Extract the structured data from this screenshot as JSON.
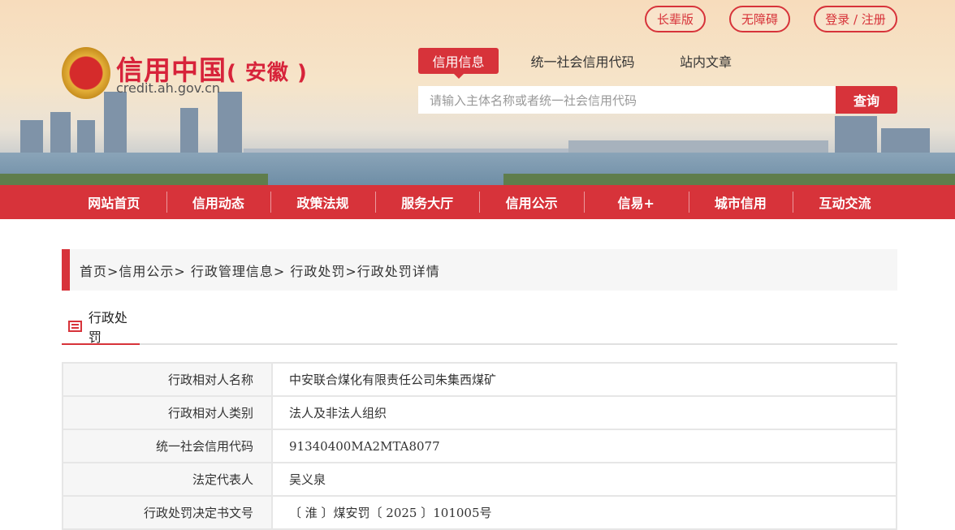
{
  "header": {
    "site_title": "信用中国",
    "site_region": "( 安徽 )",
    "site_url": "credit.ah.gov.cn",
    "top_buttons": [
      "长辈版",
      "无障碍",
      "登录 / 注册"
    ],
    "search_tabs": [
      "信用信息",
      "统一社会信用代码",
      "站内文章"
    ],
    "search_placeholder": "请输入主体名称或者统一社会信用代码",
    "search_button": "查询"
  },
  "nav": [
    "网站首页",
    "信用动态",
    "政策法规",
    "服务大厅",
    "信用公示",
    "信易+",
    "城市信用",
    "互动交流"
  ],
  "breadcrumb": "首页>信用公示> 行政管理信息> 行政处罚>行政处罚详情",
  "section_title": "行政处罚",
  "rows": [
    {
      "k": "行政相对人名称",
      "v": "中安联合煤化有限责任公司朱集西煤矿"
    },
    {
      "k": "行政相对人类别",
      "v": "法人及非法人组织"
    },
    {
      "k": "统一社会信用代码",
      "v": "91340400MA2MTA8077"
    },
    {
      "k": "法定代表人",
      "v": "吴义泉"
    },
    {
      "k": "行政处罚决定书文号",
      "v": "〔 淮 〕煤安罚〔 2025 〕101005号"
    }
  ]
}
